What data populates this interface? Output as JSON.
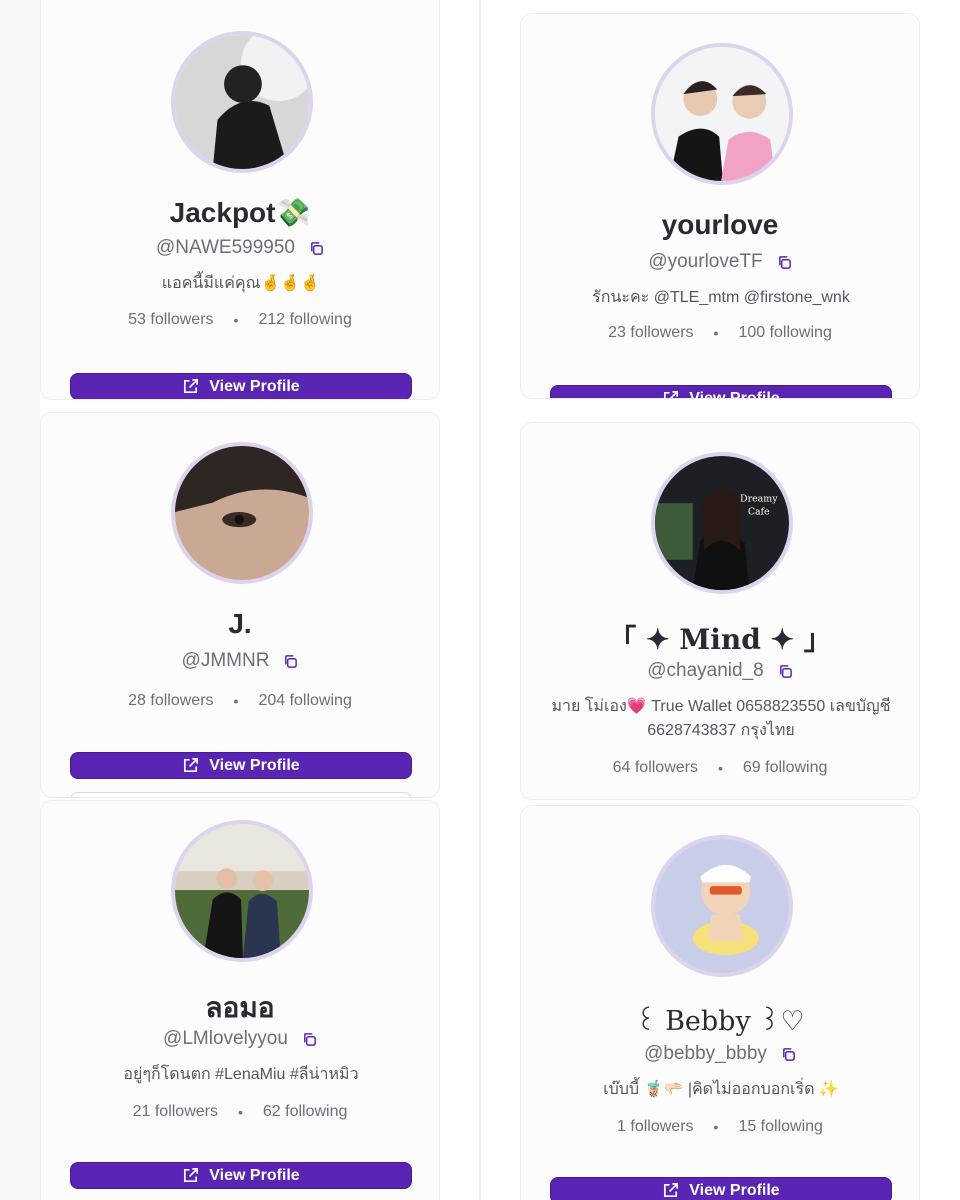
{
  "profiles": [
    {
      "name": "Jackpot💸",
      "handle": "@NAWE599950",
      "bio": "แอคนี้มีแค่คุณ🤞🤞🤞",
      "followers": "53 followers",
      "following": "212 following",
      "button": "View Profile"
    },
    {
      "name": "yourlove",
      "handle": "@yourloveTF",
      "bio": "รักนะคะ @TLE_mtm @firstone_wnk",
      "followers": "23 followers",
      "following": "100 following",
      "button": "View Profile"
    },
    {
      "name": "J.",
      "handle": "@JMMNR",
      "bio": "",
      "followers": "28 followers",
      "following": "204 following",
      "button": "View Profile"
    },
    {
      "name": "「 ✦ Mind ✦ 」",
      "handle": "@chayanid_8",
      "bio": "มาย โม่เอง💗 True Wallet 0658823550 เลขบัญชี 6628743837 กรุงไทย",
      "followers": "64 followers",
      "following": "69 following",
      "button": "View Profile"
    },
    {
      "name": "ลอมอ",
      "handle": "@LMlovelyyou",
      "bio": "อยู่ๆก็โดนตก #LenaMiu #ลีน่าหมิว",
      "followers": "21 followers",
      "following": "62 following",
      "button": "View Profile"
    },
    {
      "name": "꒰ Bebby ꒱♡",
      "handle": "@bebby_bbby",
      "bio": "เบ๊บบี้ 🧋🫳🏻 |คิดไม่ออกบอกเริ่ด ✨",
      "followers": "1 followers",
      "following": "15 following",
      "button": "View Profile"
    }
  ],
  "dot": "•",
  "colors": {
    "accent": "#5a25b4",
    "avatar_ring": "#ddd3ee"
  }
}
